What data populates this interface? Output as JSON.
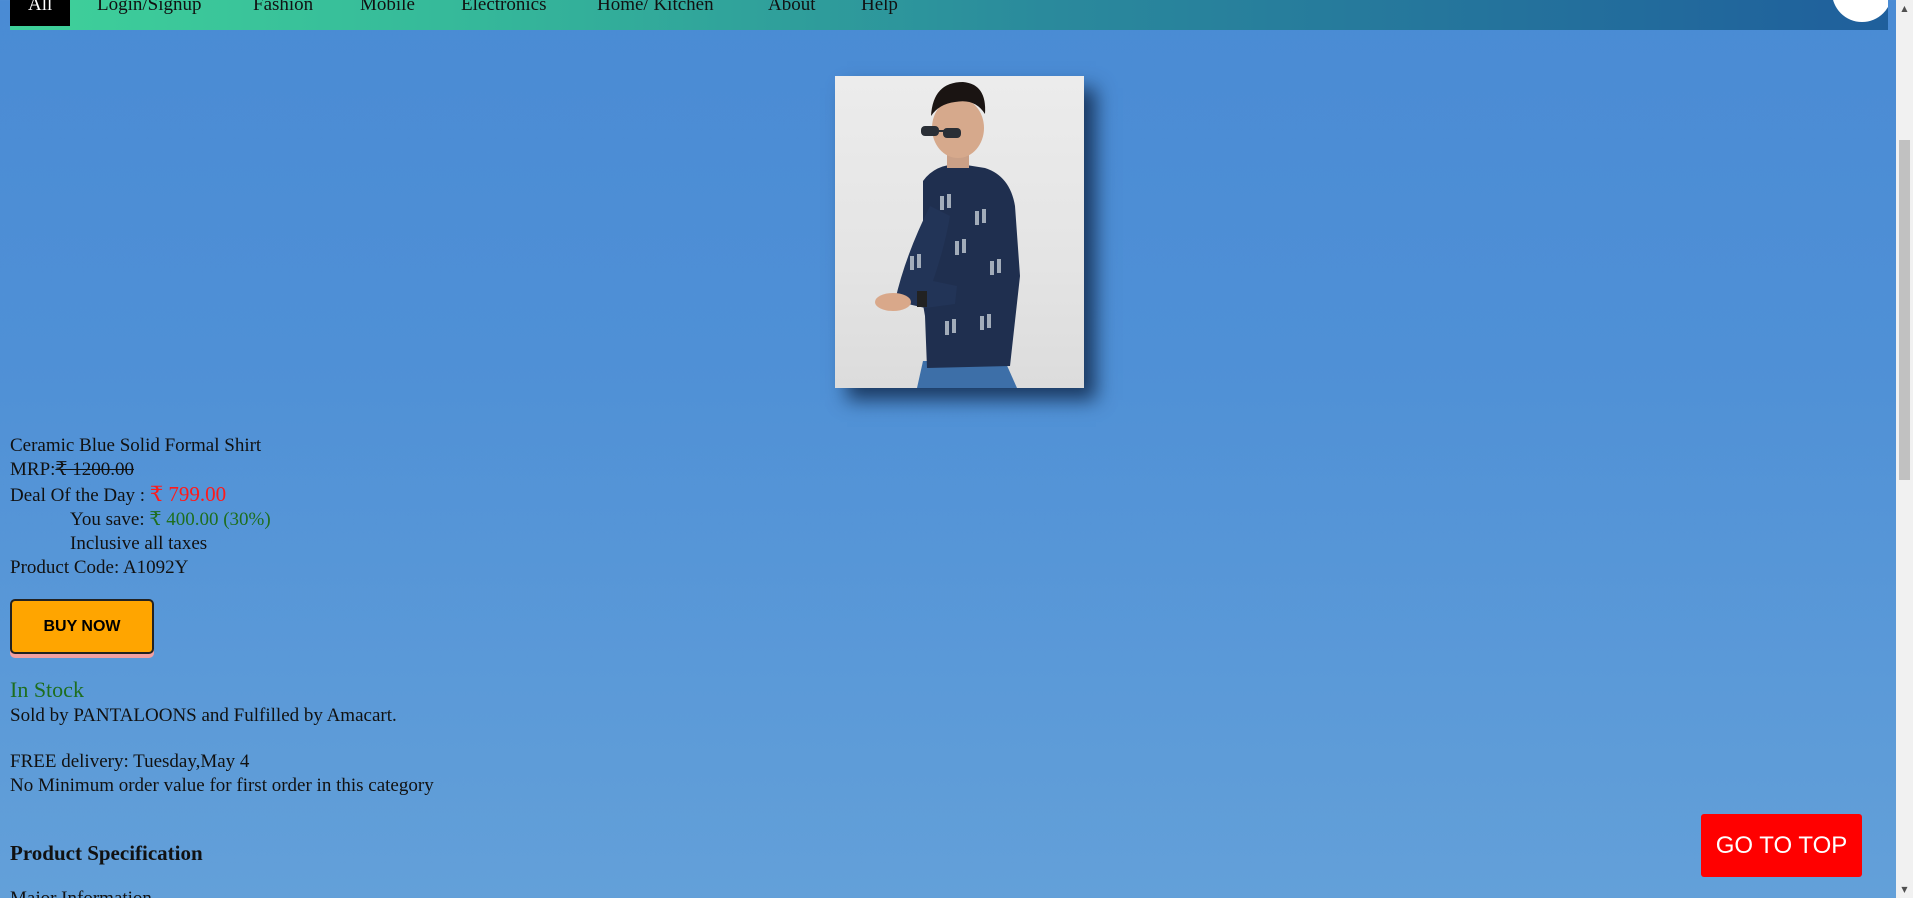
{
  "nav": {
    "items": [
      {
        "label": "All",
        "active": true
      },
      {
        "label": "Login/Signup"
      },
      {
        "label": "Fashion"
      },
      {
        "label": "Mobile"
      },
      {
        "label": "Electronics"
      },
      {
        "label": "Home/ Kitchen"
      },
      {
        "label": "About"
      },
      {
        "label": "Help"
      }
    ],
    "avatar_icon": "user-avatar-icon"
  },
  "product": {
    "image_icon": "product-photo-shirt-model",
    "name": "Ceramic Blue Solid Formal Shirt",
    "mrp_label": "MRP:",
    "mrp_value": "₹ 1200.00",
    "deal_label": "Deal Of the Day : ",
    "deal_price": "₹ 799.00",
    "save_label": "You save: ",
    "save_value": "₹ 400.00 (30%)",
    "tax_note": "Inclusive all taxes",
    "code_label": "Product Code: ",
    "code_value": "A1092Y",
    "buy_label": "BUY NOW"
  },
  "availability": {
    "status": "In Stock",
    "seller": "Sold by PANTALOONS and Fulfilled by Amacart.",
    "delivery": "FREE delivery: Tuesday,May 4",
    "min_order": "No Minimum order value for first order in this category"
  },
  "spec": {
    "heading": "Product Specification",
    "subheading": "Major Information"
  },
  "go_top_label": "GO TO TOP",
  "colors": {
    "accent_orange": "#ffa500",
    "deal_red": "#ff1a1a",
    "stock_green": "#1e6e1e",
    "go_top_red": "#ff0000"
  }
}
